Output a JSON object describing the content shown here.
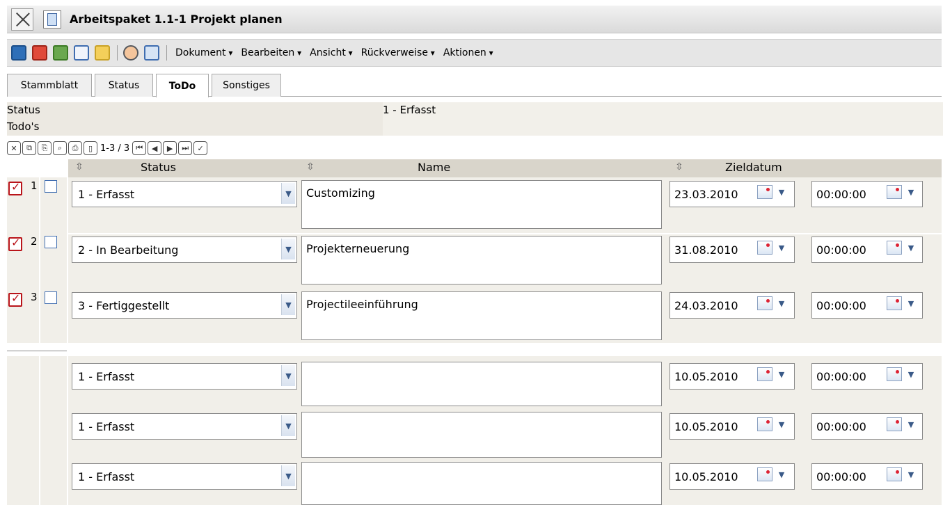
{
  "window": {
    "title": "Arbeitspaket 1.1-1 Projekt planen"
  },
  "toolbar": {
    "menus": [
      "Dokument",
      "Bearbeiten",
      "Ansicht",
      "Rückverweise",
      "Aktionen"
    ]
  },
  "tabs": [
    "Stammblatt",
    "Status",
    "ToDo",
    "Sonstiges"
  ],
  "active_tab": "ToDo",
  "info": {
    "status_label": "Status",
    "status_value": "1 - Erfasst",
    "todos_label": "Todo's"
  },
  "navigation": {
    "range": "1-3 / 3"
  },
  "grid": {
    "headers": {
      "status": "Status",
      "name": "Name",
      "date": "Zieldatum"
    },
    "rows": [
      {
        "num": "1",
        "status": "1 - Erfasst",
        "name": "Customizing",
        "date": "23.03.2010",
        "time": "00:00:00"
      },
      {
        "num": "2",
        "status": "2 - In Bearbeitung",
        "name": "Projekterneuerung",
        "date": "31.08.2010",
        "time": "00:00:00"
      },
      {
        "num": "3",
        "status": "3 - Fertiggestellt",
        "name": "Projectileeinführung",
        "date": "24.03.2010",
        "time": "00:00:00"
      }
    ],
    "new_rows": [
      {
        "status": "1 - Erfasst",
        "name": "",
        "date": "10.05.2010",
        "time": "00:00:00"
      },
      {
        "status": "1 - Erfasst",
        "name": "",
        "date": "10.05.2010",
        "time": "00:00:00"
      },
      {
        "status": "1 - Erfasst",
        "name": "",
        "date": "10.05.2010",
        "time": "00:00:00"
      }
    ]
  }
}
